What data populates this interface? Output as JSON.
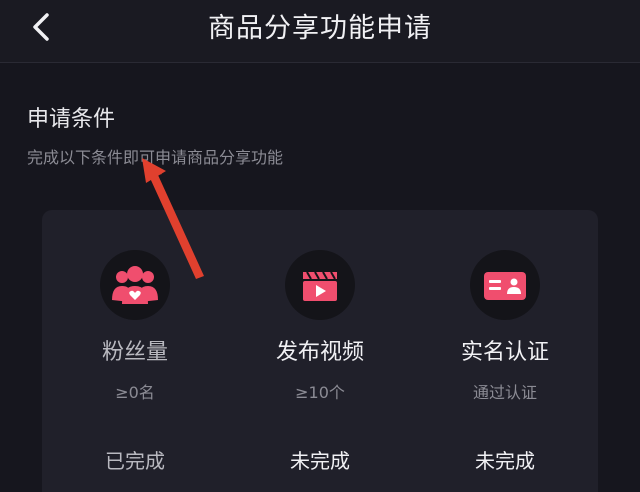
{
  "header": {
    "title": "商品分享功能申请",
    "back_icon": "chevron-left-icon"
  },
  "section": {
    "title": "申请条件",
    "subtitle": "完成以下条件即可申请商品分享功能"
  },
  "conditions": [
    {
      "icon": "fans-group-icon",
      "name": "粉丝量",
      "requirement": "≥0名",
      "status": "已完成"
    },
    {
      "icon": "video-clapper-icon",
      "name": "发布视频",
      "requirement": "≥10个",
      "status": "未完成"
    },
    {
      "icon": "id-card-icon",
      "name": "实名认证",
      "requirement": "通过认证",
      "status": "未完成"
    }
  ],
  "colors": {
    "background": "#16161e",
    "card": "#20202a",
    "icon_accent": "#f04e6e",
    "annotation_arrow": "#e0402e"
  }
}
